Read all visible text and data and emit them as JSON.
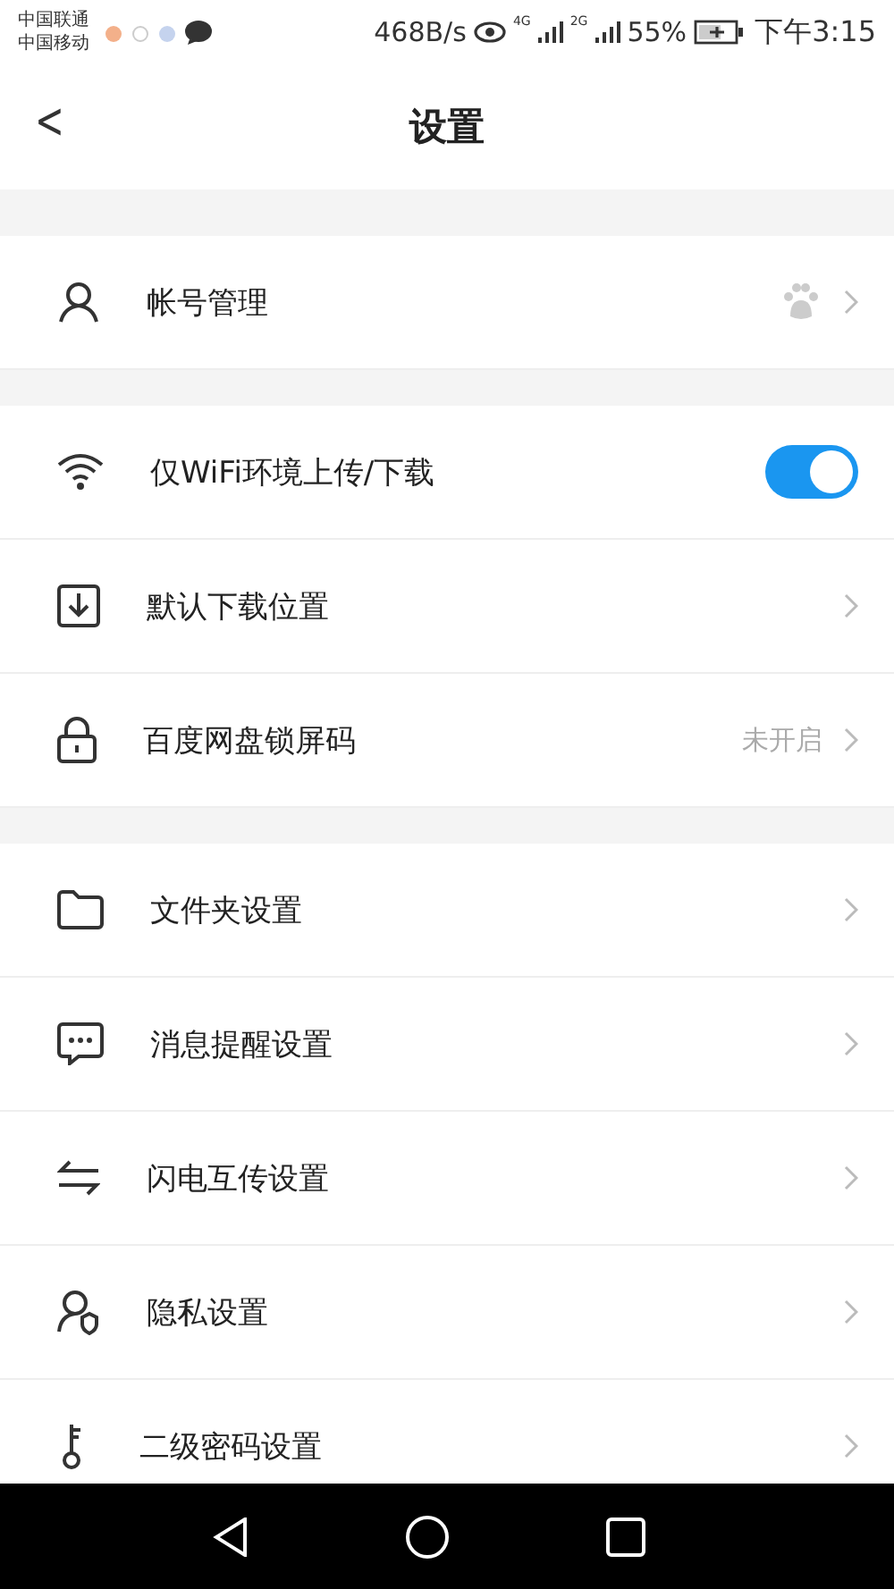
{
  "status_bar": {
    "carriers": [
      "中国联通",
      "中国移动"
    ],
    "speed": "468B/s",
    "network_1": "4G",
    "network_2": "2G",
    "battery": "55%",
    "time": "下午3:15"
  },
  "header": {
    "back": "<",
    "title": "设置"
  },
  "sections": [
    [
      {
        "kind": "account",
        "label": "帐号管理"
      }
    ],
    [
      {
        "kind": "toggle",
        "label": "仅WiFi环境上传/下载",
        "on": true
      },
      {
        "kind": "link",
        "label": "默认下载位置"
      },
      {
        "kind": "value",
        "label": "百度网盘锁屏码",
        "value": "未开启"
      }
    ],
    [
      {
        "kind": "link",
        "label": "文件夹设置"
      },
      {
        "kind": "link",
        "label": "消息提醒设置"
      },
      {
        "kind": "link",
        "label": "闪电互传设置"
      },
      {
        "kind": "link",
        "label": "隐私设置"
      },
      {
        "kind": "link",
        "label": "二级密码设置"
      }
    ]
  ]
}
